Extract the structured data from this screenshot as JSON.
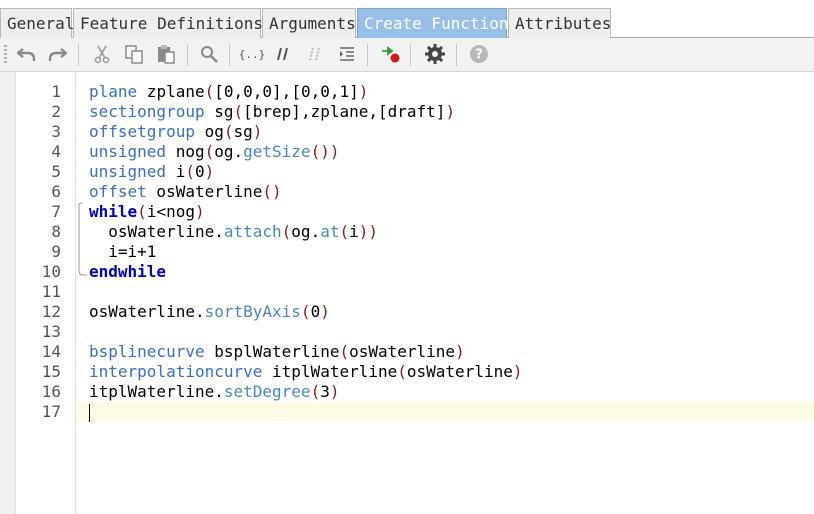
{
  "tabs": [
    {
      "label": "General",
      "active": false
    },
    {
      "label": "Feature Definitions",
      "active": false
    },
    {
      "label": "Arguments",
      "active": false
    },
    {
      "label": "Create Function",
      "active": true
    },
    {
      "label": "Attributes",
      "active": false
    }
  ],
  "toolbar": {
    "buttons": [
      "undo-icon",
      "redo-icon",
      "cut-icon",
      "copy-icon",
      "paste-icon",
      "find-icon",
      "braces-icon",
      "comment-icon",
      "uncomment-icon",
      "indent-icon",
      "insert-breakpoint-icon",
      "settings-gear-icon",
      "help-icon"
    ]
  },
  "colors": {
    "tab_active": "#98bfe8",
    "keyword": "#3a6ec9",
    "keyword_bold": "#0000d0",
    "method": "#4a86c5",
    "paren": "#8b1c1c",
    "current_line": "#fdfbe6"
  },
  "editor": {
    "current_line": 17,
    "lines": [
      {
        "n": "1",
        "tokens": [
          [
            "kw",
            "plane"
          ],
          [
            "id",
            " zplane"
          ],
          [
            "par",
            "("
          ],
          [
            "id",
            "[0,0,0],[0,0,1]"
          ],
          [
            "par",
            ")"
          ]
        ]
      },
      {
        "n": "2",
        "tokens": [
          [
            "kw",
            "sectiongroup"
          ],
          [
            "id",
            " sg"
          ],
          [
            "par",
            "("
          ],
          [
            "id",
            "[brep],zplane,[draft]"
          ],
          [
            "par",
            ")"
          ]
        ]
      },
      {
        "n": "3",
        "tokens": [
          [
            "kw",
            "offsetgroup"
          ],
          [
            "id",
            " og"
          ],
          [
            "par",
            "("
          ],
          [
            "id",
            "sg"
          ],
          [
            "par",
            ")"
          ]
        ]
      },
      {
        "n": "4",
        "tokens": [
          [
            "kw",
            "unsigned"
          ],
          [
            "id",
            " nog"
          ],
          [
            "par",
            "("
          ],
          [
            "id",
            "og."
          ],
          [
            "fn",
            "getSize"
          ],
          [
            "par",
            "()"
          ],
          [
            "par",
            ")"
          ]
        ]
      },
      {
        "n": "5",
        "tokens": [
          [
            "kw",
            "unsigned"
          ],
          [
            "id",
            " i"
          ],
          [
            "par",
            "("
          ],
          [
            "id",
            "0"
          ],
          [
            "par",
            ")"
          ]
        ]
      },
      {
        "n": "6",
        "tokens": [
          [
            "kw",
            "offset"
          ],
          [
            "id",
            " osWaterline"
          ],
          [
            "par",
            "()"
          ]
        ]
      },
      {
        "n": "7",
        "tokens": [
          [
            "kwb",
            "while"
          ],
          [
            "par",
            "("
          ],
          [
            "id",
            "i<nog"
          ],
          [
            "par",
            ")"
          ]
        ]
      },
      {
        "n": "8",
        "tokens": [
          [
            "id",
            "  osWaterline."
          ],
          [
            "fn",
            "attach"
          ],
          [
            "par",
            "("
          ],
          [
            "id",
            "og."
          ],
          [
            "fn",
            "at"
          ],
          [
            "par",
            "("
          ],
          [
            "id",
            "i"
          ],
          [
            "par",
            ")"
          ],
          [
            "par",
            ")"
          ]
        ]
      },
      {
        "n": "9",
        "tokens": [
          [
            "id",
            "  i=i+1"
          ]
        ]
      },
      {
        "n": "10",
        "tokens": [
          [
            "kwb",
            "endwhile"
          ]
        ]
      },
      {
        "n": "11",
        "tokens": []
      },
      {
        "n": "12",
        "tokens": [
          [
            "id",
            "osWaterline."
          ],
          [
            "fn",
            "sortByAxis"
          ],
          [
            "par",
            "("
          ],
          [
            "id",
            "0"
          ],
          [
            "par",
            ")"
          ]
        ]
      },
      {
        "n": "13",
        "tokens": []
      },
      {
        "n": "14",
        "tokens": [
          [
            "kw",
            "bsplinecurve"
          ],
          [
            "id",
            " bsplWaterline"
          ],
          [
            "par",
            "("
          ],
          [
            "id",
            "osWaterline"
          ],
          [
            "par",
            ")"
          ]
        ]
      },
      {
        "n": "15",
        "tokens": [
          [
            "kw",
            "interpolationcurve"
          ],
          [
            "id",
            " itplWaterline"
          ],
          [
            "par",
            "("
          ],
          [
            "id",
            "osWaterline"
          ],
          [
            "par",
            ")"
          ]
        ]
      },
      {
        "n": "16",
        "tokens": [
          [
            "id",
            "itplWaterline."
          ],
          [
            "fn",
            "setDegree"
          ],
          [
            "par",
            "("
          ],
          [
            "id",
            "3"
          ],
          [
            "par",
            ")"
          ]
        ]
      },
      {
        "n": "17",
        "tokens": []
      }
    ]
  }
}
